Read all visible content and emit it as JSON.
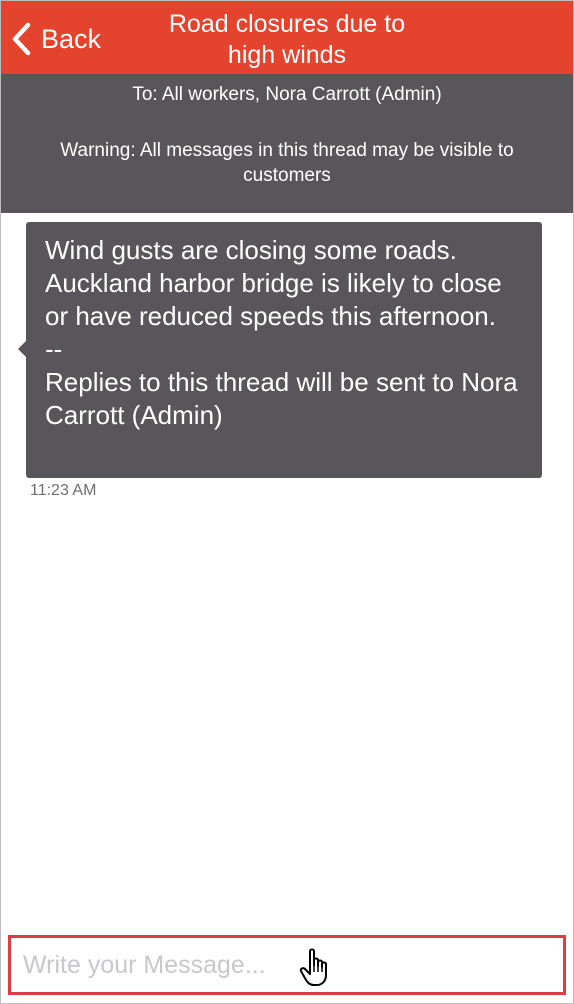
{
  "navbar": {
    "back_label": "Back",
    "back_icon": "chevron-left-icon",
    "title": "Road closures due to\nhigh winds"
  },
  "info": {
    "recipients": "To: All workers, Nora Carrott (Admin)",
    "warning": "Warning: All messages in this thread may be visible to customers"
  },
  "messages": [
    {
      "text": "Wind gusts are closing some roads. Auckland harbor bridge is likely to close or have reduced speeds this afternoon.\n--\nReplies to this thread will be sent to Nora Carrott (Admin)",
      "time": "11:23 AM"
    }
  ],
  "composer": {
    "placeholder": "Write your Message...",
    "value": ""
  },
  "pointer": "hand-pointer-icon",
  "colors": {
    "accent": "#e4432e",
    "panel": "#58565a",
    "highlight": "#e03a45"
  }
}
